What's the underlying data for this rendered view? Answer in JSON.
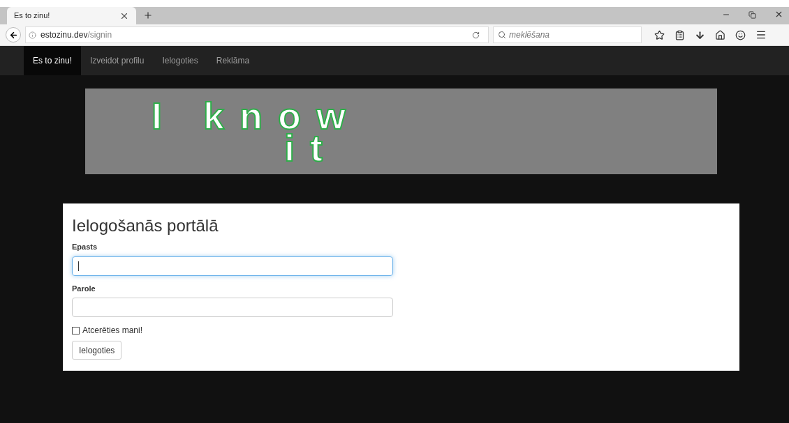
{
  "browser": {
    "tab_title": "Es to zinu!",
    "url_host": "estozinu.dev",
    "url_path": "/signin",
    "search_placeholder": "meklēšana"
  },
  "navbar": {
    "items": [
      {
        "label": "Es to zinu!",
        "selected": true
      },
      {
        "label": "Izveidot profilu",
        "selected": false
      },
      {
        "label": "Ielogoties",
        "selected": false
      },
      {
        "label": "Reklāma",
        "selected": false
      }
    ]
  },
  "banner": {
    "lines": [
      "I know",
      "it"
    ]
  },
  "form": {
    "title": "Ielogošanās portālā",
    "fields": [
      {
        "label": "Epasts",
        "focused": true
      },
      {
        "label": "Parole",
        "focused": false
      }
    ],
    "remember": {
      "label": "Atcerēties mani!",
      "checked": false
    },
    "submit": "Ielogoties"
  }
}
